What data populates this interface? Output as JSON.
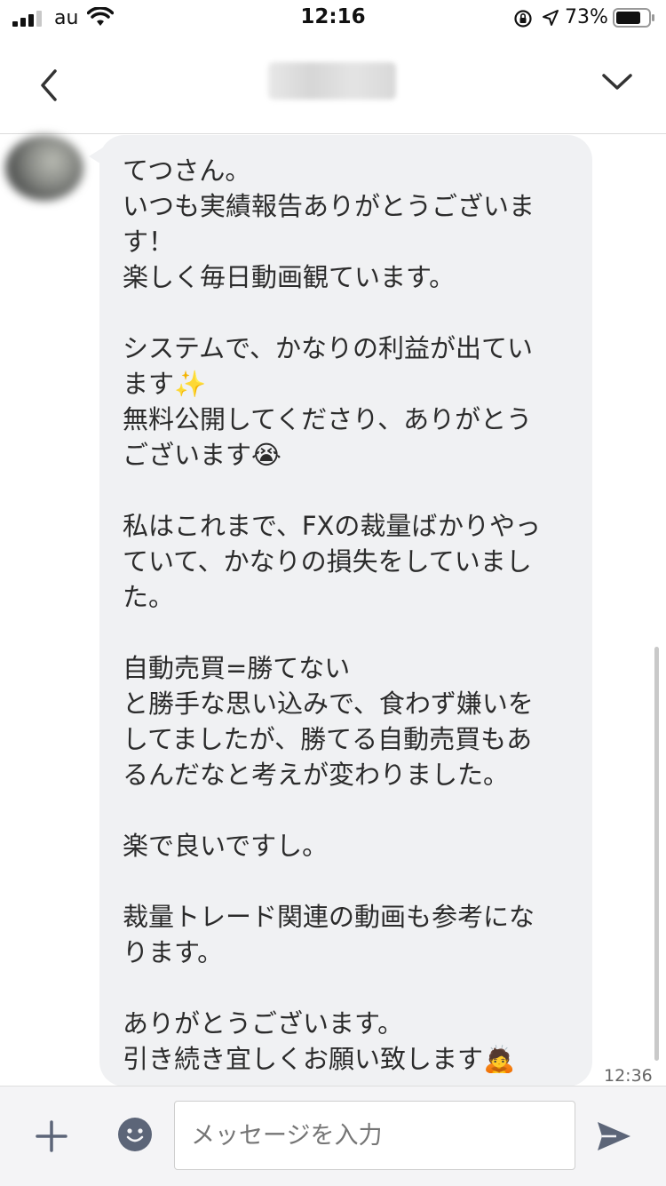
{
  "status_bar": {
    "carrier": "au",
    "time": "12:16",
    "battery": "73%"
  },
  "header": {
    "contact_name_blurred": ""
  },
  "message": {
    "lines": [
      "てつさん。",
      "いつも実績報告ありがとうございま",
      "す！",
      "楽しく毎日動画観ています。",
      "",
      "システムで、かなりの利益が出てい",
      "ます✨",
      "無料公開してくださり、ありがとう",
      "ございます😭",
      "",
      "私はこれまで、FXの裁量ばかりやっ",
      "ていて、かなりの損失をしていまし",
      "た。",
      "",
      "自動売買=勝てない",
      "と勝手な思い込みで、食わず嫌いを",
      "してましたが、勝てる自動売買もあ",
      "るんだなと考えが変わりました。",
      "",
      "楽で良いですし。",
      "",
      "裁量トレード関連の動画も参考にな",
      "ります。",
      "",
      "ありがとうございます。",
      "引き続き宜しくお願い致します🙇"
    ],
    "timestamp": "12:36"
  },
  "input_bar": {
    "placeholder": "メッセージを入力"
  },
  "icons": {
    "back": "chevron-left-icon",
    "menu": "chevron-down-icon",
    "add": "plus-icon",
    "emoji": "smiley-icon",
    "send": "send-icon"
  },
  "colors": {
    "bubble": "#f0f1f3",
    "icon": "#5c6578"
  }
}
